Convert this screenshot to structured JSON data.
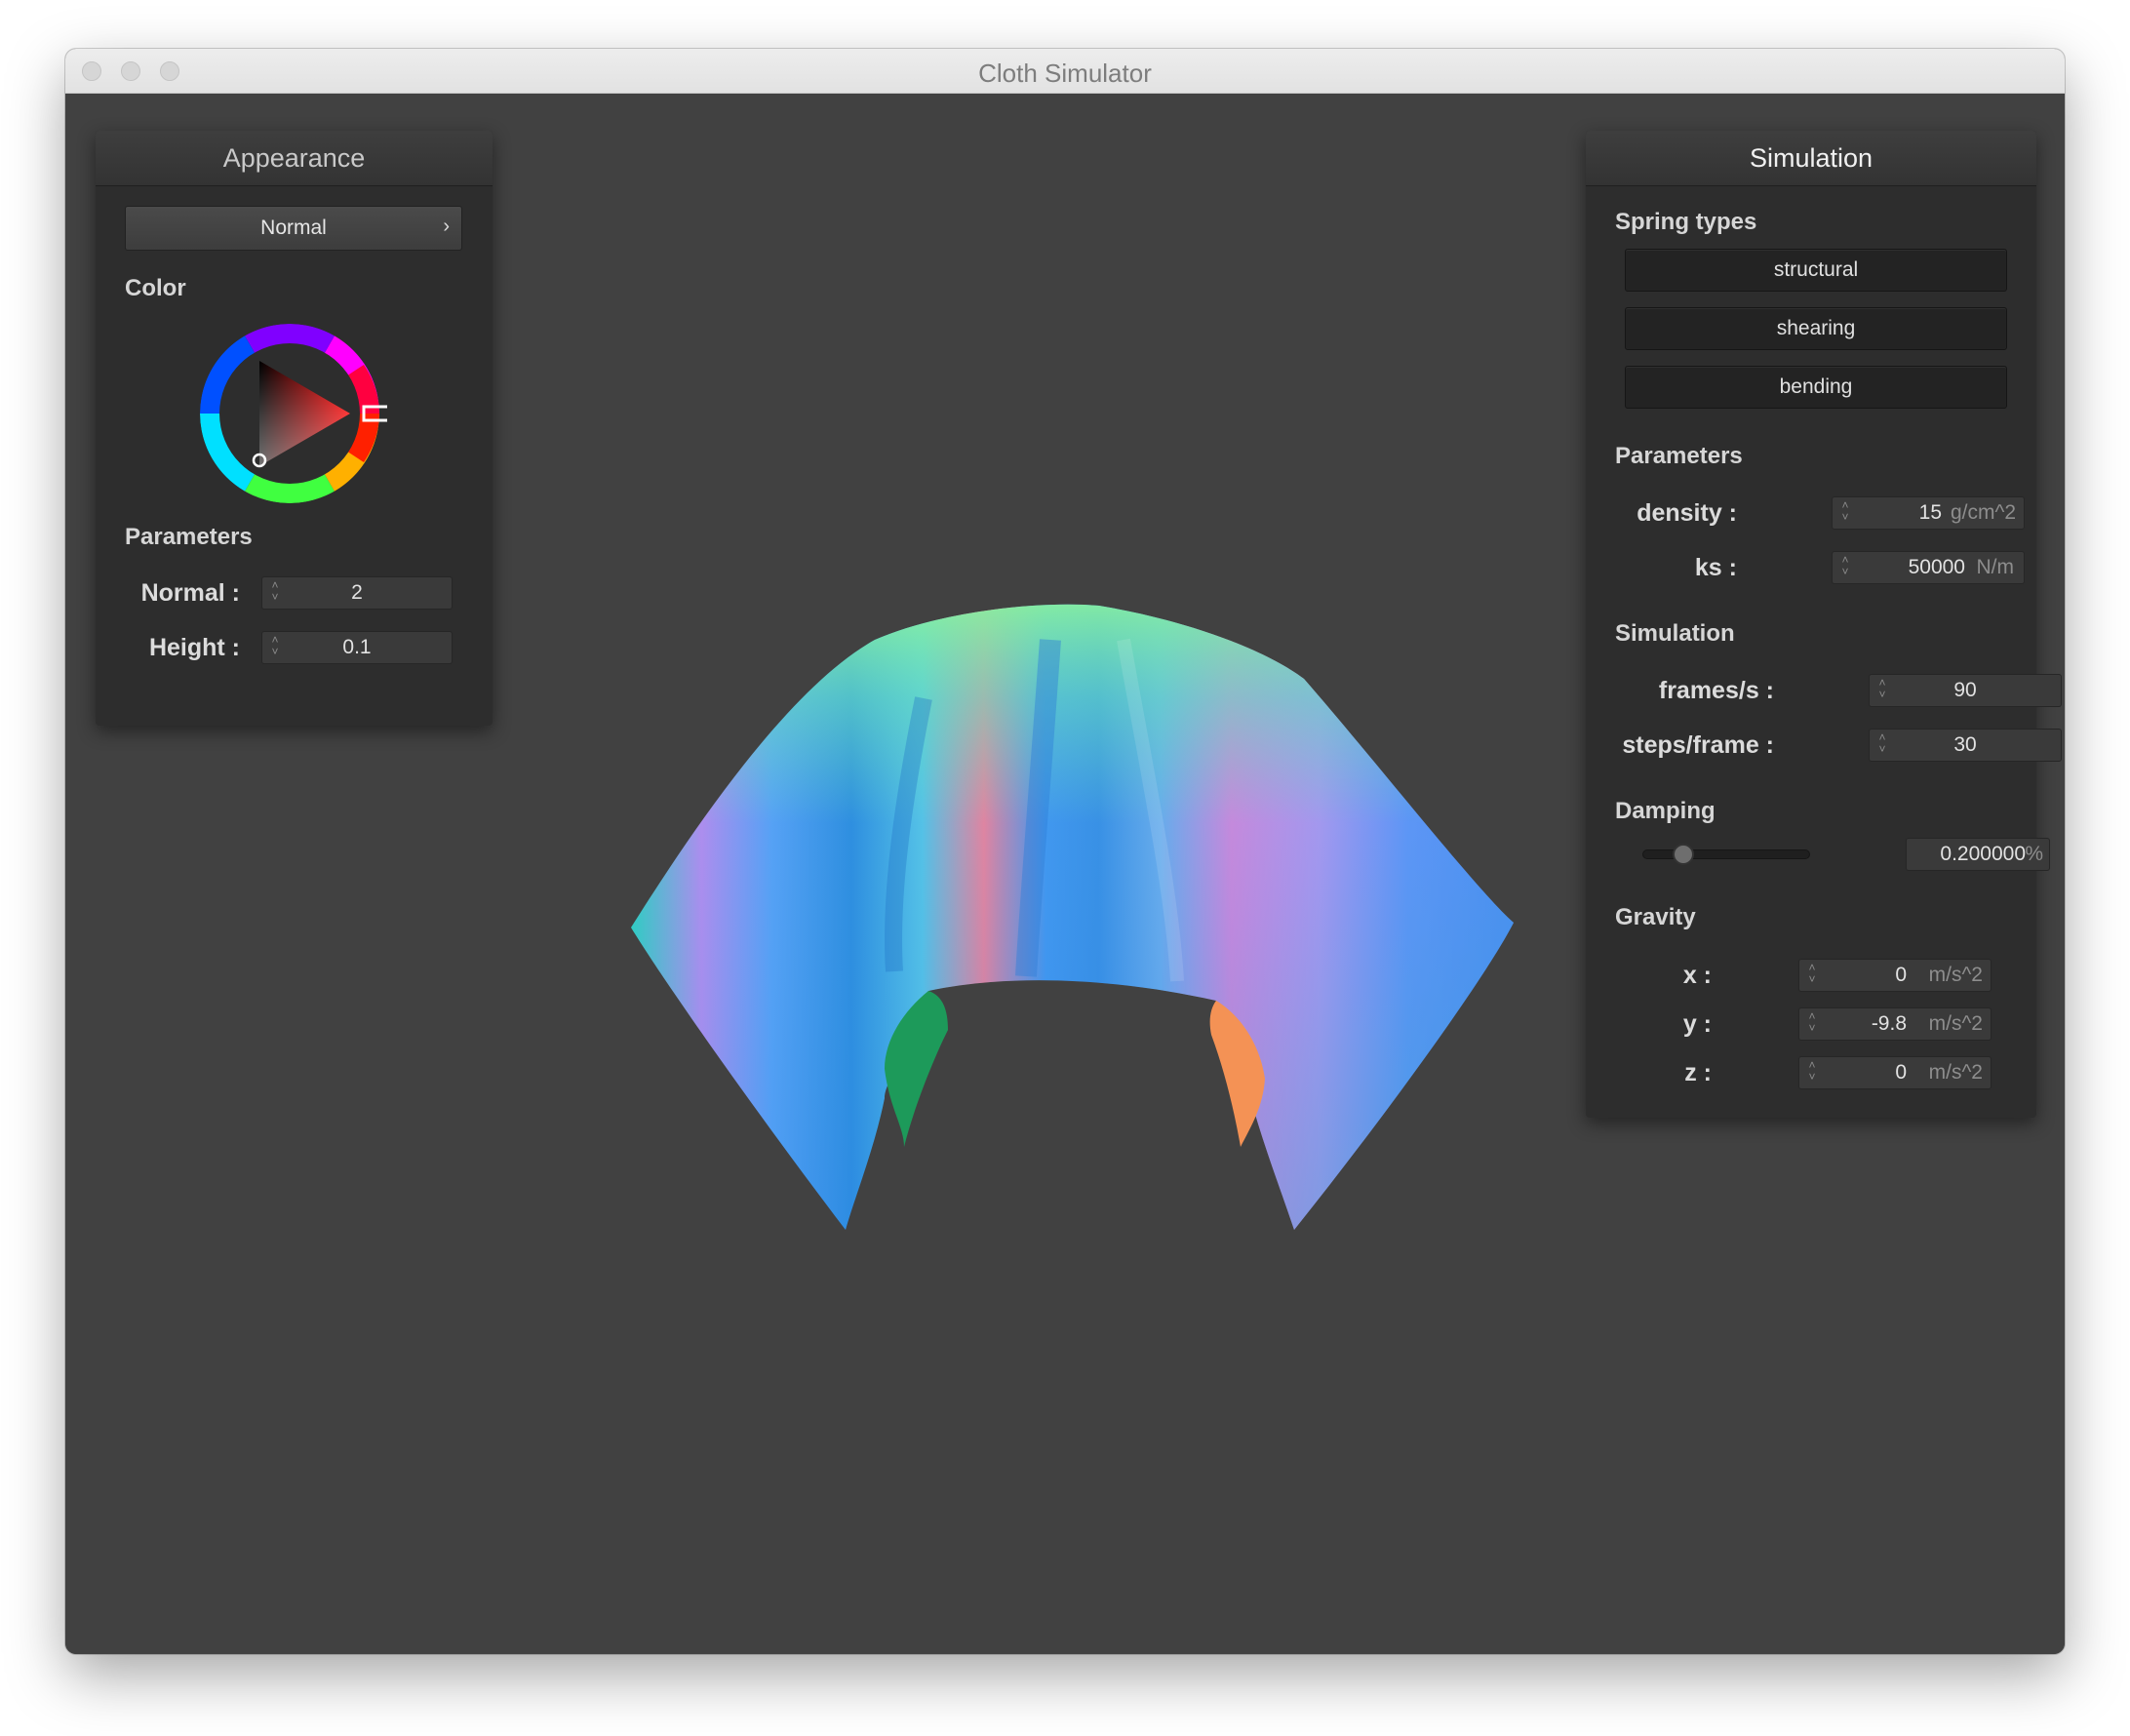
{
  "window": {
    "title": "Cloth Simulator"
  },
  "appearance": {
    "title": "Appearance",
    "shader_select": "Normal",
    "color_label": "Color",
    "params_label": "Parameters",
    "normal_label": "Normal :",
    "normal_value": "2",
    "height_label": "Height :",
    "height_value": "0.1",
    "selected_color": "#ff0000"
  },
  "simulation": {
    "title": "Simulation",
    "spring_types_label": "Spring types",
    "spring_buttons": [
      "structural",
      "shearing",
      "bending"
    ],
    "params_label": "Parameters",
    "density_label": "density :",
    "density_value": "15",
    "density_unit": "g/cm^2",
    "ks_label": "ks :",
    "ks_value": "50000",
    "ks_unit": "N/m",
    "sim_label": "Simulation",
    "fps_label": "frames/s :",
    "fps_value": "90",
    "steps_label": "steps/frame :",
    "steps_value": "30",
    "damping_label": "Damping",
    "damping_value": "0.200000",
    "damping_unit": "%",
    "damping_slider_fraction": 0.2,
    "gravity_label": "Gravity",
    "gx_label": "x :",
    "gx_value": "0",
    "gy_label": "y :",
    "gy_value": "-9.8",
    "gz_label": "z :",
    "gz_value": "0",
    "gravity_unit": "m/s^2"
  }
}
